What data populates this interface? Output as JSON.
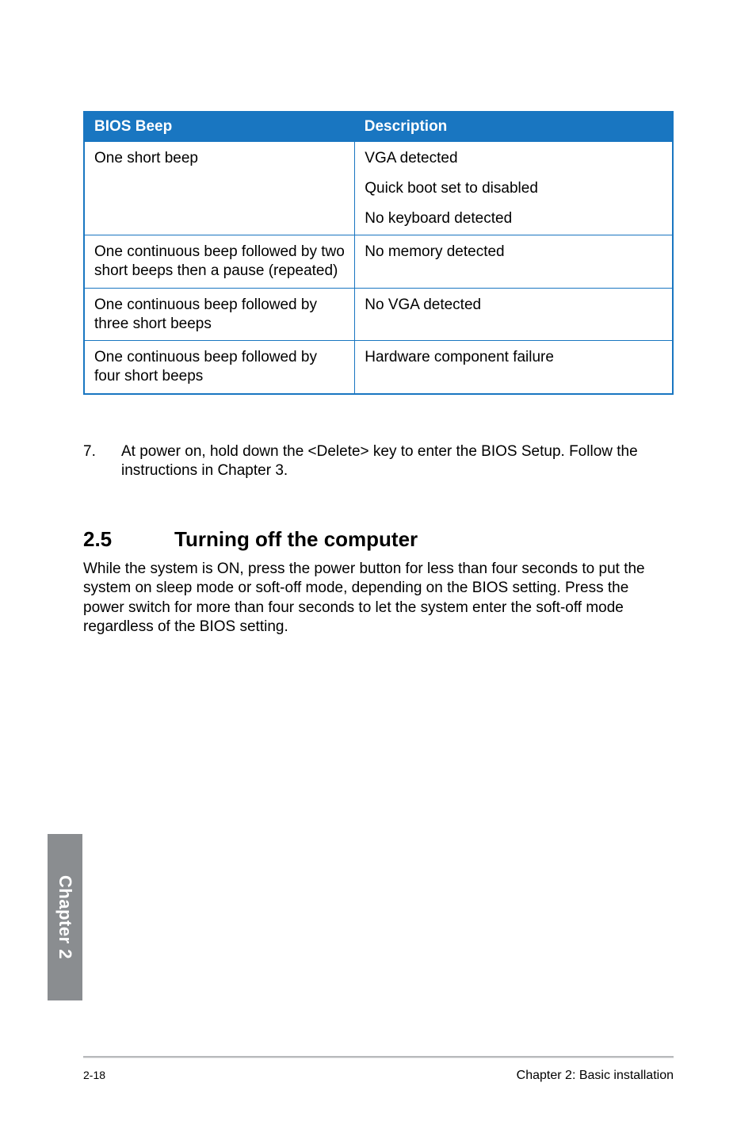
{
  "table": {
    "headers": [
      "BIOS Beep",
      "Description"
    ],
    "rows": [
      {
        "beep": "One short beep",
        "desc_lines": [
          "VGA detected",
          "Quick boot set to disabled",
          "No keyboard detected"
        ]
      },
      {
        "beep": "One continuous beep followed by two short beeps then a pause (repeated)",
        "desc_lines": [
          "No memory detected"
        ]
      },
      {
        "beep": "One continuous beep followed by three short beeps",
        "desc_lines": [
          "No VGA detected"
        ]
      },
      {
        "beep": "One continuous beep followed by four short beeps",
        "desc_lines": [
          "Hardware component failure"
        ]
      }
    ]
  },
  "step": {
    "num": "7.",
    "text": "At power on, hold down the <Delete> key to enter the BIOS Setup. Follow the instructions in Chapter 3."
  },
  "section": {
    "num": "2.5",
    "title": "Turning off the computer",
    "body": "While the system is ON, press the power button for less than four seconds to put the system on sleep mode or soft-off mode, depending on the BIOS setting. Press the power switch for more than four seconds to let the system enter the soft-off mode regardless of the BIOS setting."
  },
  "chapter_tab": "Chapter 2",
  "footer": {
    "page": "2-18",
    "chapter": "Chapter 2: Basic installation"
  }
}
